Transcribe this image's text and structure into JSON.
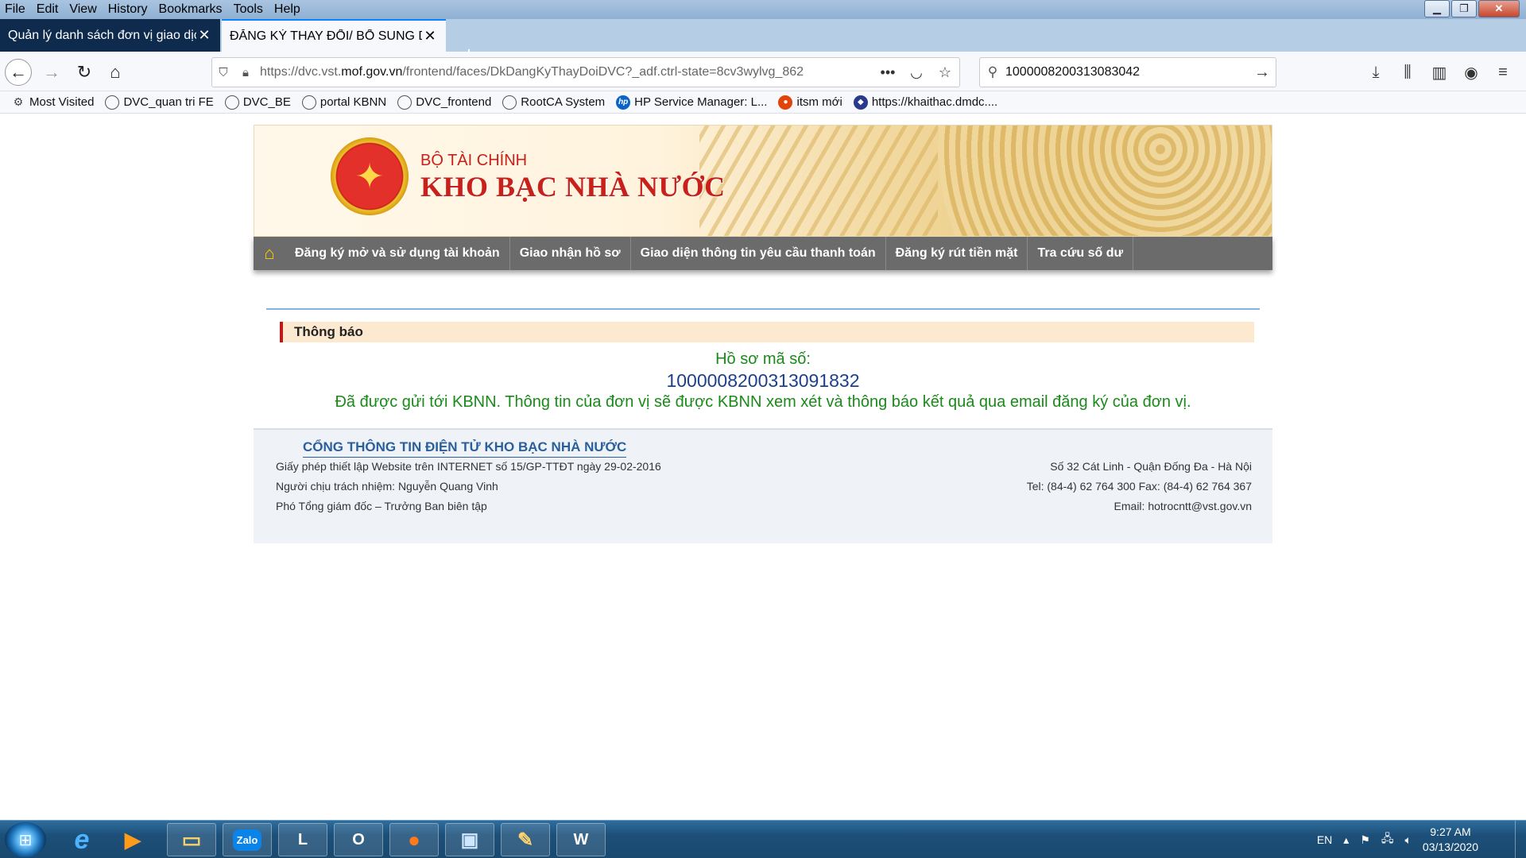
{
  "browser": {
    "menu": [
      "File",
      "Edit",
      "View",
      "History",
      "Bookmarks",
      "Tools",
      "Help"
    ],
    "tabs": [
      {
        "title": "Quản lý danh sách đơn vị giao dịch",
        "close": "✕"
      },
      {
        "title": "ĐĂNG KÝ THAY ĐỔI/ BỔ SUNG DỊCH",
        "close": "✕"
      }
    ],
    "new_tab": "+",
    "url_prefix": "https://dvc.vst.",
    "url_domain": "mof.gov.vn",
    "url_rest": "/frontend/faces/DkDangKyThayDoiDVC?_adf.ctrl-state=8cv3wylvg_862",
    "search_value": "1000008200313083042",
    "bookmarks": [
      "Most Visited",
      "DVC_quan tri FE",
      "DVC_BE",
      "portal KBNN",
      "DVC_frontend",
      "RootCA System",
      "HP Service Manager: L...",
      "itsm mới",
      "https://khaithac.dmdc...."
    ]
  },
  "site": {
    "org_sub": "BỘ TÀI CHÍNH",
    "org_name": "KHO BẠC NHÀ NƯỚC",
    "nav": [
      "Đăng ký mở và sử dụng tài khoản",
      "Giao nhận hồ sơ",
      "Giao diện thông tin yêu cầu thanh toán",
      "Đăng ký rút tiền mặt",
      "Tra cứu số dư"
    ]
  },
  "notice": {
    "heading": "Thông báo",
    "label": "Hồ sơ mã số:",
    "code": "1000008200313091832",
    "message": "Đã được gửi tới KBNN. Thông tin của đơn vị sẽ được KBNN xem xét và thông báo kết quả qua email đăng ký của đơn vị."
  },
  "footer": {
    "title": "CỔNG THÔNG TIN ĐIỆN TỬ KHO BẠC NHÀ NƯỚC",
    "left": [
      "Giấy phép thiết lập Website trên INTERNET số 15/GP-TTĐT ngày 29-02-2016",
      "Người chịu trách nhiệm: Nguyễn Quang Vinh",
      "Phó Tổng giám đốc – Trưởng Ban biên tập"
    ],
    "right": [
      "Số 32 Cát Linh - Quận Đống Đa - Hà Nội",
      "Tel: (84-4) 62 764 300 Fax: (84-4) 62 764 367",
      "Email: hotrocntt@vst.gov.vn"
    ]
  },
  "taskbar": {
    "apps": [
      "internet-explorer",
      "media-player",
      "file-explorer",
      "zalo",
      "lync",
      "outlook",
      "firefox",
      "remote-desktop",
      "paint",
      "word"
    ],
    "zalo_label": "Zalo",
    "lang": "EN",
    "time": "9:27 AM",
    "date": "03/13/2020"
  }
}
